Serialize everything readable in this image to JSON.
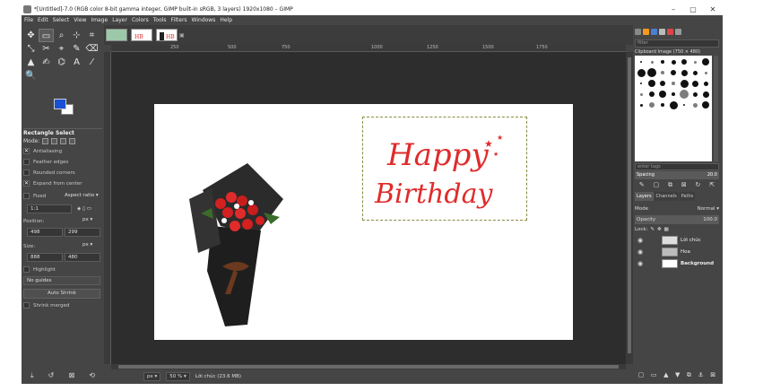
{
  "window": {
    "title": "*[Untitled]-7.0 (RGB color 8-bit gamma integer, GIMP built-in sRGB, 3 layers) 1920x1080 – GIMP",
    "minimize": "–",
    "maximize": "▢",
    "close": "✕"
  },
  "menu": [
    "File",
    "Edit",
    "Select",
    "View",
    "Image",
    "Layer",
    "Colors",
    "Tools",
    "Filters",
    "Windows",
    "Help"
  ],
  "toolbox": {
    "tools": [
      "✥",
      "▭",
      "⌕",
      "⊹",
      "⌗",
      "⤡",
      "✂",
      "⌖",
      "✎",
      "⌫",
      "▲",
      "✍",
      "⌬",
      "A",
      "⁄",
      "🔍"
    ],
    "options_title": "Rectangle Select",
    "mode_label": "Mode:",
    "antialiasing": "Antialiasing",
    "feather_edges": "Feather edges",
    "rounded_corners": "Rounded corners",
    "expand_from_center": "Expand from center",
    "fixed": "Fixed",
    "aspect_ratio": "Aspect ratio",
    "ratio_value": "1:1",
    "position_label": "Position:",
    "position_unit": "px",
    "pos_x": "498",
    "pos_y": "299",
    "size_label": "Size:",
    "size_unit": "px",
    "size_w": "888",
    "size_h": "480",
    "highlight": "Highlight",
    "guides": "No guides",
    "auto_shrink": "Auto Shrink",
    "shrink_merged": "Shrink merged"
  },
  "ruler_labels": [
    "250",
    "500",
    "750",
    "1000",
    "1250",
    "1500",
    "1750"
  ],
  "canvas": {
    "birthday_line1": "Happy",
    "birthday_line2": "Birthday"
  },
  "status": {
    "unit": "px",
    "zoom": "50 %",
    "layer_info": "Lời chúc (23.6 MB)"
  },
  "dock": {
    "filter_placeholder": "filter",
    "brush_name": "Clipboard Image (750 × 480)",
    "tag_placeholder": "enter tags",
    "spacing_label": "Spacing",
    "spacing_value": "20.0",
    "tabs": [
      "Layers",
      "Channels",
      "Paths"
    ],
    "mode_label": "Mode",
    "mode_value": "Normal",
    "opacity_label": "Opacity",
    "opacity_value": "100.0",
    "lock_label": "Lock:",
    "layers": [
      {
        "name": "Lời chúc"
      },
      {
        "name": "Hoa"
      },
      {
        "name": "Background"
      }
    ]
  },
  "colors": {
    "foreground": "#1a4fd6",
    "background": "#ffffff",
    "birthday_text": "#e02b2b"
  }
}
